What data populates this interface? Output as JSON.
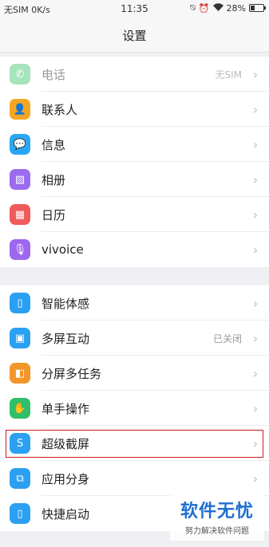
{
  "status": {
    "left": "无SIM 0K/s",
    "time": "11:35",
    "battery": "28%",
    "battery_fraction": 0.28,
    "icons": [
      "alarm-off-icon",
      "alarm-icon",
      "wifi-icon",
      "battery-icon"
    ]
  },
  "title": "设置",
  "group1": [
    {
      "label": "电话",
      "value": "无SIM",
      "icon": "phone-icon",
      "color": "#3cc46b",
      "glyph": "✆",
      "disabled": true
    },
    {
      "label": "联系人",
      "value": "",
      "icon": "contacts-icon",
      "color": "#f5a623",
      "glyph": "👤",
      "disabled": false
    },
    {
      "label": "信息",
      "value": "",
      "icon": "message-icon",
      "color": "#2aa7f4",
      "glyph": "💬",
      "disabled": false
    },
    {
      "label": "相册",
      "value": "",
      "icon": "gallery-icon",
      "color": "#9b6cf0",
      "glyph": "▨",
      "disabled": false
    },
    {
      "label": "日历",
      "value": "",
      "icon": "calendar-icon",
      "color": "#f05a5a",
      "glyph": "▦",
      "disabled": false
    },
    {
      "label": "vivoice",
      "value": "",
      "icon": "microphone-icon",
      "color": "#9d67ef",
      "glyph": "🎙",
      "disabled": false
    }
  ],
  "group2": [
    {
      "label": "智能体感",
      "value": "",
      "icon": "smart-motion-icon",
      "color": "#2ba0f2",
      "glyph": "▯",
      "disabled": false
    },
    {
      "label": "多屏互动",
      "value": "已关闭",
      "icon": "multi-screen-icon",
      "color": "#2ba0f2",
      "glyph": "▣",
      "disabled": false
    },
    {
      "label": "分屏多任务",
      "value": "",
      "icon": "split-screen-icon",
      "color": "#f4952a",
      "glyph": "◧",
      "disabled": false
    },
    {
      "label": "单手操作",
      "value": "",
      "icon": "one-hand-icon",
      "color": "#2fbf6a",
      "glyph": "✋",
      "disabled": false
    },
    {
      "label": "超级截屏",
      "value": "",
      "icon": "screenshot-icon",
      "color": "#2ba0f2",
      "glyph": "S",
      "disabled": false
    },
    {
      "label": "应用分身",
      "value": "",
      "icon": "app-clone-icon",
      "color": "#2ba0f2",
      "glyph": "⧉",
      "disabled": false
    },
    {
      "label": "快捷启动",
      "value": "",
      "icon": "quick-launch-icon",
      "color": "#2ba0f2",
      "glyph": "▯",
      "disabled": false
    }
  ],
  "chevron": "›",
  "watermark": {
    "main": "软件无忧",
    "sub": "努力解决软件问题"
  }
}
